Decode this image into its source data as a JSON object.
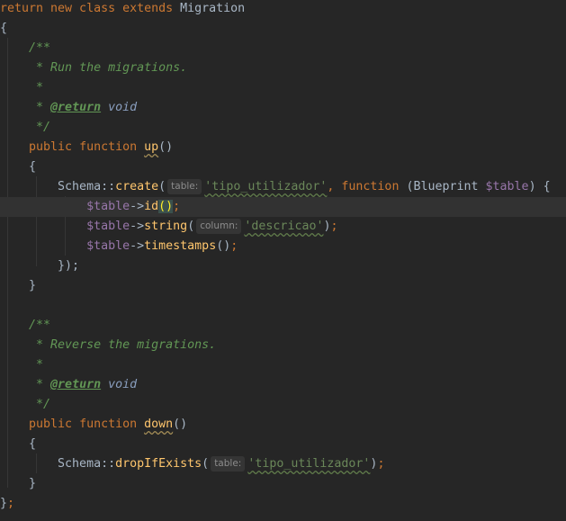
{
  "editor": {
    "current_line": 10,
    "colors": {
      "background": "#262626",
      "keyword": "#cc7832",
      "comment": "#629755",
      "string": "#6a8759",
      "variable": "#9876aa",
      "function": "#ffc66d",
      "text": "#a9b7c6"
    },
    "lines": [
      [
        [
          "kw",
          "return new class extends "
        ],
        [
          "cls",
          "Migration"
        ]
      ],
      [
        [
          "pn",
          "{"
        ]
      ],
      [
        [
          "pn",
          "    "
        ],
        [
          "cm",
          "/**"
        ]
      ],
      [
        [
          "pn",
          "     "
        ],
        [
          "cm",
          "* Run the migrations."
        ]
      ],
      [
        [
          "pn",
          "     "
        ],
        [
          "cm",
          "*"
        ]
      ],
      [
        [
          "pn",
          "     "
        ],
        [
          "cm",
          "* "
        ],
        [
          "tag",
          "@return"
        ],
        [
          "cm",
          " "
        ],
        [
          "tv",
          "void"
        ]
      ],
      [
        [
          "pn",
          "     "
        ],
        [
          "cm",
          "*/"
        ]
      ],
      [
        [
          "pn",
          "    "
        ],
        [
          "kw",
          "public function "
        ],
        [
          "fn",
          "up"
        ],
        [
          "pn",
          "()"
        ]
      ],
      [
        [
          "pn",
          "    {"
        ]
      ],
      [
        [
          "pn",
          "        Schema::"
        ],
        [
          "fnc",
          "create"
        ],
        [
          "pn",
          "("
        ],
        [
          "hint",
          "table:"
        ],
        [
          "str",
          "'tipo_utilizador'"
        ],
        [
          "kw",
          ", function "
        ],
        [
          "pn",
          "(Blueprint "
        ],
        [
          "var",
          "$table"
        ],
        [
          "pn",
          ") {"
        ]
      ],
      [
        [
          "pn",
          "            "
        ],
        [
          "var",
          "$table"
        ],
        [
          "pn",
          "->"
        ],
        [
          "fnc",
          "id"
        ],
        [
          "br",
          "()"
        ],
        [
          "semi",
          ";"
        ]
      ],
      [
        [
          "pn",
          "            "
        ],
        [
          "var",
          "$table"
        ],
        [
          "pn",
          "->"
        ],
        [
          "fnc",
          "string"
        ],
        [
          "pn",
          "("
        ],
        [
          "hint",
          "column:"
        ],
        [
          "str",
          "'descricao'"
        ],
        [
          "pn",
          ")"
        ],
        [
          "semi",
          ";"
        ]
      ],
      [
        [
          "pn",
          "            "
        ],
        [
          "var",
          "$table"
        ],
        [
          "pn",
          "->"
        ],
        [
          "fnc",
          "timestamps"
        ],
        [
          "pn",
          "()"
        ],
        [
          "semi",
          ";"
        ]
      ],
      [
        [
          "pn",
          "        });"
        ]
      ],
      [
        [
          "pn",
          "    }"
        ]
      ],
      [],
      [
        [
          "pn",
          "    "
        ],
        [
          "cm",
          "/**"
        ]
      ],
      [
        [
          "pn",
          "     "
        ],
        [
          "cm",
          "* Reverse the migrations."
        ]
      ],
      [
        [
          "pn",
          "     "
        ],
        [
          "cm",
          "*"
        ]
      ],
      [
        [
          "pn",
          "     "
        ],
        [
          "cm",
          "* "
        ],
        [
          "tag",
          "@return"
        ],
        [
          "cm",
          " "
        ],
        [
          "tv",
          "void"
        ]
      ],
      [
        [
          "pn",
          "     "
        ],
        [
          "cm",
          "*/"
        ]
      ],
      [
        [
          "pn",
          "    "
        ],
        [
          "kw",
          "public function "
        ],
        [
          "fn",
          "down"
        ],
        [
          "pn",
          "()"
        ]
      ],
      [
        [
          "pn",
          "    {"
        ]
      ],
      [
        [
          "pn",
          "        Schema::"
        ],
        [
          "fnc",
          "dropIfExists"
        ],
        [
          "pn",
          "("
        ],
        [
          "hint",
          "table:"
        ],
        [
          "str",
          "'tipo_utilizador'"
        ],
        [
          "pn",
          ")"
        ],
        [
          "semi",
          ";"
        ]
      ],
      [
        [
          "pn",
          "    }"
        ]
      ],
      [
        [
          "pn",
          "}"
        ],
        [
          "semi",
          ";"
        ]
      ]
    ]
  }
}
